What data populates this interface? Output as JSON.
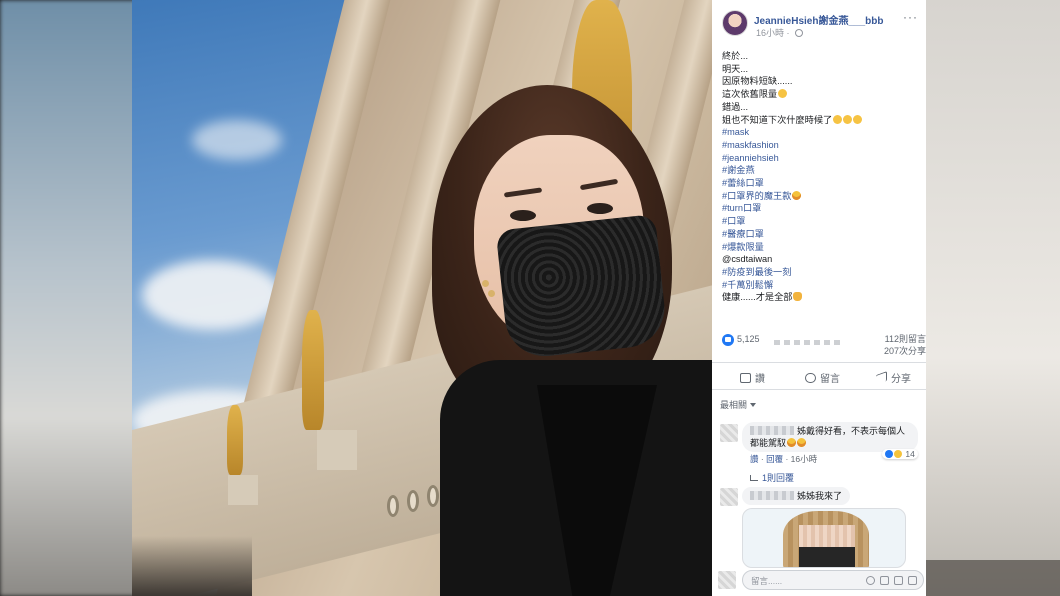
{
  "post": {
    "author": "JeannieHsieh謝金燕___bbb",
    "time": "16小時",
    "more": "···",
    "lines": [
      {
        "text": "終於..."
      },
      {
        "text": "明天..."
      },
      {
        "text": "因原物料短缺......"
      },
      {
        "text": "這次依舊限量",
        "emoji": "face"
      },
      {
        "text": "錯過..."
      },
      {
        "text": "姐也不知道下次什麼時候了",
        "emoji": "face3"
      },
      {
        "text": "#mask",
        "tag": true
      },
      {
        "text": "#maskfashion",
        "tag": true
      },
      {
        "text": "#jeanniehsieh",
        "tag": true
      },
      {
        "text": "#謝金燕",
        "tag": true
      },
      {
        "text": "#蕾絲口罩",
        "tag": true
      },
      {
        "text": "#口罩界的魔王款",
        "tag": true,
        "emoji": "laugh"
      },
      {
        "text": "#turn口罩",
        "tag": true
      },
      {
        "text": "#口罩",
        "tag": true
      },
      {
        "text": "#醫療口罩",
        "tag": true
      },
      {
        "text": "#爆款限量",
        "tag": true
      },
      {
        "text": "@csdtaiwan"
      },
      {
        "text": "#防疫到最後一刻",
        "tag": true
      },
      {
        "text": "#千萬別鬆懈",
        "tag": true
      },
      {
        "text": "健康......才是全部",
        "emoji": "hand"
      }
    ]
  },
  "stats": {
    "likes": "5,125",
    "comments": "112則留言",
    "shares": "207次分享"
  },
  "actions": {
    "like": "讚",
    "comment": "留言",
    "share": "分享"
  },
  "sort_label": "最相關",
  "comments": [
    {
      "text_line1": "姊戴得好看，不表示每個人",
      "text_line2": "都能駕馭",
      "like_label": "讚",
      "reply_label": "回覆",
      "time": "16小時",
      "reaction_count": "14",
      "replies": "1則回覆"
    },
    {
      "text_line1": "姊姊我來了"
    }
  ],
  "composer": {
    "placeholder": "留言......"
  }
}
